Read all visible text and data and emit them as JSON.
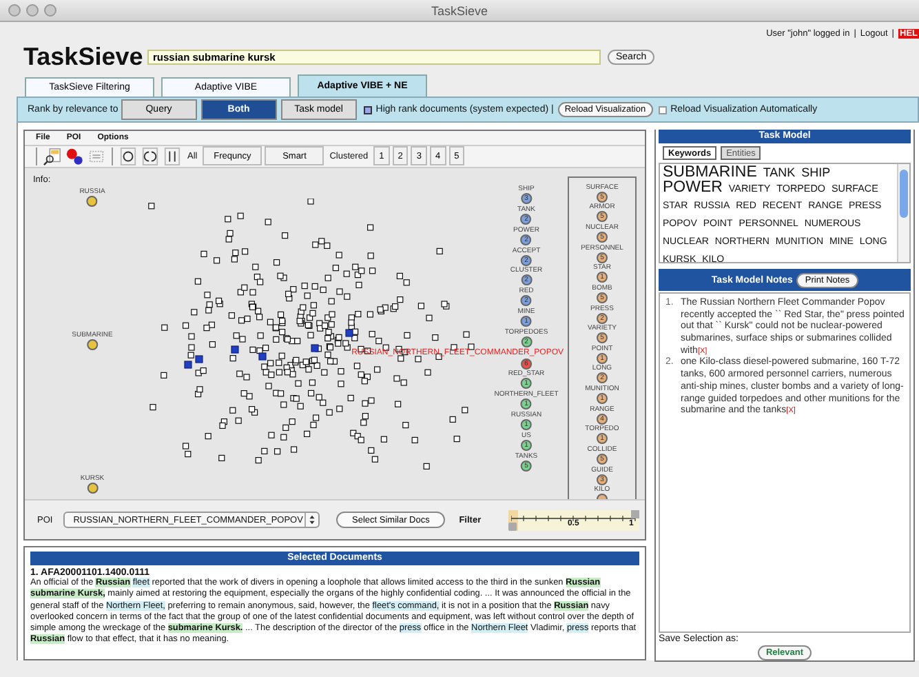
{
  "window": {
    "title": "TaskSieve"
  },
  "header": {
    "logo": "TaskSieve",
    "search": {
      "value": "russian submarine kursk"
    },
    "search_button": "Search",
    "user_text": "User \"john\" logged in",
    "separator": "|",
    "logout": "Logout",
    "help": "HEL"
  },
  "tabs": [
    {
      "label": "TaskSieve Filtering",
      "selected": false
    },
    {
      "label": "Adaptive VIBE",
      "selected": false
    },
    {
      "label": "Adaptive VIBE + NE",
      "selected": true
    }
  ],
  "rank_bar": {
    "label": "Rank by relevance to",
    "options": [
      {
        "label": "Query",
        "selected": false
      },
      {
        "label": "Both",
        "selected": true
      },
      {
        "label": "Task model",
        "selected": false
      }
    ],
    "legend": "High rank documents (system expected) |",
    "reload_button": "Reload Visualization",
    "auto_reload": {
      "label": "Reload Visualization Automatically",
      "checked": false
    }
  },
  "vibe": {
    "menu": [
      "File",
      "POI",
      "Options"
    ],
    "toolbar": [
      {
        "kind": "label",
        "text": "All"
      },
      {
        "kind": "button",
        "text": "Frequncy"
      },
      {
        "kind": "button",
        "text": "Smart"
      },
      {
        "kind": "label",
        "text": "Clustered"
      },
      {
        "kind": "button",
        "text": "1"
      },
      {
        "kind": "button",
        "text": "2"
      },
      {
        "kind": "button",
        "text": "3"
      },
      {
        "kind": "button",
        "text": "4"
      },
      {
        "kind": "button",
        "text": "5"
      }
    ],
    "info_label": "Info:",
    "fixed_pois": [
      {
        "name": "RUSSIA",
        "color": "#e6c23e"
      },
      {
        "name": "SUBMARINE",
        "color": "#e6c23e"
      },
      {
        "name": "KURSK",
        "color": "#e6c23e"
      }
    ],
    "pois": [
      {
        "name": "SHIP",
        "count": "3",
        "color": "#7d9fd9",
        "selected": false
      },
      {
        "name": "TANK",
        "count": "2",
        "color": "#7d9fd9",
        "selected": false
      },
      {
        "name": "POWER",
        "count": "2",
        "color": "#7d9fd9",
        "selected": false
      },
      {
        "name": "ACCEPT",
        "count": "2",
        "color": "#7d9fd9",
        "selected": false
      },
      {
        "name": "CLUSTER",
        "count": "2",
        "color": "#7d9fd9",
        "selected": false
      },
      {
        "name": "RED",
        "count": "2",
        "color": "#7d9fd9",
        "selected": false
      },
      {
        "name": "MINE",
        "count": "1",
        "color": "#7d9fd9",
        "selected": false
      },
      {
        "name": "TORPEDOES",
        "count": "2",
        "color": "#7bd08f",
        "selected": false
      },
      {
        "name": "RUSSIAN_NORTHERN_FLEET_COMMANDER_POPOV",
        "count": "6",
        "color": "#e8524a",
        "selected": true
      },
      {
        "name": "RED_STAR",
        "count": "1",
        "color": "#7bd08f",
        "selected": false
      },
      {
        "name": "NORTHERN_FLEET",
        "count": "1",
        "color": "#7bd08f",
        "selected": false
      },
      {
        "name": "RUSSIAN",
        "count": "1",
        "color": "#7bd08f",
        "selected": false
      },
      {
        "name": "US",
        "count": "1",
        "color": "#7bd08f",
        "selected": false
      },
      {
        "name": "TANKS",
        "count": "5",
        "color": "#7bd08f",
        "selected": false
      }
    ],
    "boxed_pois": [
      {
        "name": "SURFACE",
        "count": "5",
        "color": "#e2ae7c"
      },
      {
        "name": "ARMOR",
        "count": "5",
        "color": "#e2ae7c"
      },
      {
        "name": "NUCLEAR",
        "count": "5",
        "color": "#e2ae7c"
      },
      {
        "name": "PERSONNEL",
        "count": "5",
        "color": "#e2ae7c"
      },
      {
        "name": "STAR",
        "count": "1",
        "color": "#e2ae7c"
      },
      {
        "name": "BOMB",
        "count": "5",
        "color": "#e2ae7c"
      },
      {
        "name": "PRESS",
        "count": "2",
        "color": "#e2ae7c"
      },
      {
        "name": "VARIETY",
        "count": "5",
        "color": "#e2ae7c"
      },
      {
        "name": "POINT",
        "count": "1",
        "color": "#e2ae7c"
      },
      {
        "name": "LONG",
        "count": "2",
        "color": "#e2ae7c"
      },
      {
        "name": "MUNITION",
        "count": "1",
        "color": "#e2ae7c"
      },
      {
        "name": "RANGE",
        "count": "4",
        "color": "#e2ae7c"
      },
      {
        "name": "TORPEDO",
        "count": "1",
        "color": "#e2ae7c"
      },
      {
        "name": "COLLIDE",
        "count": "5",
        "color": "#e2ae7c"
      },
      {
        "name": "GUIDE",
        "count": "3",
        "color": "#e2ae7c"
      },
      {
        "name": "KILO",
        "color": "#e2ae7c"
      }
    ],
    "poi_select": {
      "label": "POI",
      "value": "RUSSIAN_NORTHERN_FLEET_COMMANDER_POPOV"
    },
    "similar_button": "Select Similar Docs",
    "filter": {
      "label": "Filter",
      "level": 0,
      "ticks": [
        "0.5",
        "1"
      ]
    }
  },
  "selected_documents": {
    "title": "Selected Documents",
    "documents": [
      {
        "heading": "1. AFA20001101.1400.0111",
        "segments": [
          {
            "text": "An official of the ",
            "kind": "plain"
          },
          {
            "text": "Russian",
            "kind": "query"
          },
          {
            "text": " fleet",
            "kind": "model"
          },
          {
            "text": " reported that the work of divers in opening a loophole that allows limited access to the third in the sunken ",
            "kind": "plain"
          },
          {
            "text": "Russian submarine Kursk,",
            "kind": "query"
          },
          {
            "text": " mainly aimed at restoring the equipment, especially the organs of the highly confidential coding. ... It was announced the official in the general staff of the ",
            "kind": "plain"
          },
          {
            "text": "Northern Fleet,",
            "kind": "model"
          },
          {
            "text": " preferring to remain anonymous, said, however, the ",
            "kind": "plain"
          },
          {
            "text": "fleet's command,",
            "kind": "model"
          },
          {
            "text": " it is not in a position that the ",
            "kind": "plain"
          },
          {
            "text": "Russian",
            "kind": "query"
          },
          {
            "text": " navy overlooked concern in terms of the fact that the group of one of the latest confidential documents and equipment, was left without control over the depth of simple among the wreckage of the ",
            "kind": "plain"
          },
          {
            "text": "submarine Kursk.",
            "kind": "query"
          },
          {
            "text": " ... The description of the director of the ",
            "kind": "plain"
          },
          {
            "text": "press",
            "kind": "model"
          },
          {
            "text": " office in the ",
            "kind": "plain"
          },
          {
            "text": "Northern Fleet",
            "kind": "model"
          },
          {
            "text": " Vladimir, ",
            "kind": "plain"
          },
          {
            "text": "press",
            "kind": "model"
          },
          {
            "text": " reports that ",
            "kind": "plain"
          },
          {
            "text": "Russian",
            "kind": "query"
          },
          {
            "text": " flow to that effect, that it has no meaning.",
            "kind": "plain"
          }
        ]
      }
    ]
  },
  "task_model": {
    "title": "Task Model",
    "tabs": [
      {
        "label": "Keywords",
        "selected": true
      },
      {
        "label": "Entities",
        "selected": false
      }
    ],
    "keywords": [
      {
        "text": "SUBMARINE",
        "kind": "xl"
      },
      {
        "text": "TANK",
        "kind": "l"
      },
      {
        "text": "SHIP",
        "kind": "l"
      },
      {
        "text": "POWER",
        "kind": "xl"
      },
      {
        "text": "VARIETY",
        "kind": "m"
      },
      {
        "text": "TORPEDO",
        "kind": "m"
      },
      {
        "text": "SURFACE",
        "kind": "m"
      },
      {
        "text": "STAR",
        "kind": "s"
      },
      {
        "text": "RUSSIA",
        "kind": "s"
      },
      {
        "text": "RED",
        "kind": "s"
      },
      {
        "text": "RECENT",
        "kind": "s"
      },
      {
        "text": "RANGE",
        "kind": "s"
      },
      {
        "text": "PRESS",
        "kind": "s"
      },
      {
        "text": "POPOV",
        "kind": "s"
      },
      {
        "text": "POINT",
        "kind": "s"
      },
      {
        "text": "PERSONNEL",
        "kind": "s"
      },
      {
        "text": "NUMEROUS",
        "kind": "s"
      },
      {
        "text": "NUCLEAR",
        "kind": "s"
      },
      {
        "text": "NORTHERN",
        "kind": "s"
      },
      {
        "text": "MUNITION",
        "kind": "s"
      },
      {
        "text": "MINE",
        "kind": "s"
      },
      {
        "text": "LONG",
        "kind": "s"
      },
      {
        "text": "KURSK",
        "kind": "s"
      },
      {
        "text": "KILO",
        "kind": "s"
      }
    ],
    "notes_title": "Task Model Notes",
    "print_button": "Print Notes",
    "notes": [
      {
        "number": "1.",
        "text": "The Russian Northern Fleet Commander Popov recently accepted the `` Red Star, the\" press pointed out that `` Kursk\" could not be nuclear-powered submarines, surface ships or submarines collided with",
        "remove": "[X]"
      },
      {
        "number": "2.",
        "text": "one Kilo-class diesel-powered submarine, 160 T-72 tanks, 600 armored personnel carriers, numerous anti-ship mines, cluster bombs and a variety of long-range guided torpedoes and other munitions for the submarine and the tanks",
        "remove": "[X]"
      }
    ],
    "save_label": "Save Selection as:",
    "relevant_button": "Relevant"
  }
}
